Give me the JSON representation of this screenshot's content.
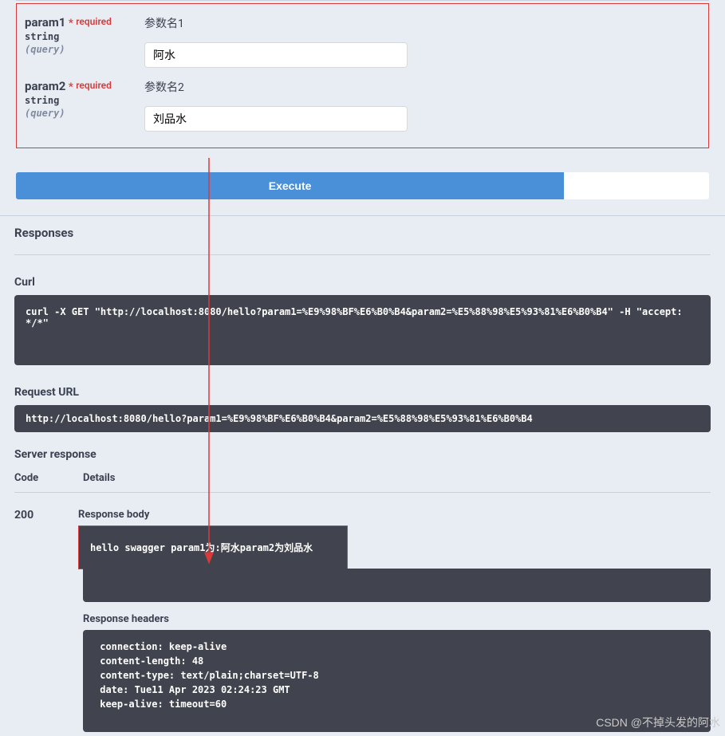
{
  "params": {
    "p1": {
      "name": "param1",
      "required_star": "*",
      "required_label": "required",
      "type": "string",
      "in": "(query)",
      "desc": "参数名1",
      "value": "阿水"
    },
    "p2": {
      "name": "param2",
      "required_star": "*",
      "required_label": "required",
      "type": "string",
      "in": "(query)",
      "desc": "参数名2",
      "value": "刘品水"
    }
  },
  "execute_label": "Execute",
  "responses_title": "Responses",
  "curl_label": "Curl",
  "curl_command": "curl -X GET \"http://localhost:8080/hello?param1=%E9%98%BF%E6%B0%B4&param2=%E5%88%98%E5%93%81%E6%B0%B4\" -H \"accept: */*\"",
  "request_url_label": "Request URL",
  "request_url": "http://localhost:8080/hello?param1=%E9%98%BF%E6%B0%B4&param2=%E5%88%98%E5%93%81%E6%B0%B4",
  "server_response_label": "Server response",
  "code_header": "Code",
  "details_header": "Details",
  "response_code": "200",
  "response_body_label": "Response body",
  "response_body": "hello swagger param1为:阿水param2为刘品水",
  "response_headers_label": "Response headers",
  "response_headers": " connection: keep-alive \n content-length: 48 \n content-type: text/plain;charset=UTF-8 \n date: Tue11 Apr 2023 02:24:23 GMT \n keep-alive: timeout=60 ",
  "watermark": "CSDN @不掉头发的阿水"
}
